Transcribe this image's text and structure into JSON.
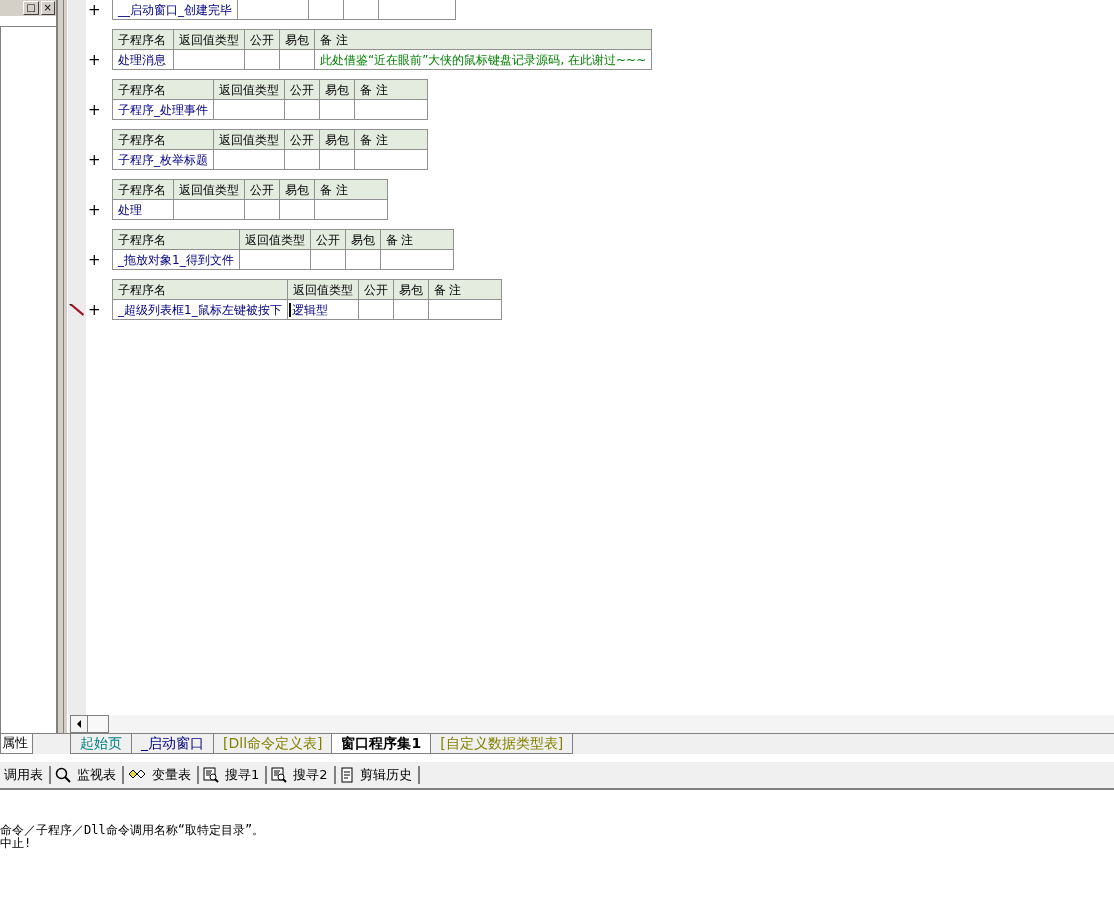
{
  "left_panel": {
    "buttons": [
      "□",
      "×"
    ],
    "tab": "属性"
  },
  "procedures": [
    {
      "name": "__启动窗口_创建完毕",
      "editing": false
    },
    {
      "columns": [
        "子程序名",
        "返回值类型",
        "公开",
        "易包",
        "备 注"
      ],
      "name": "处理消息",
      "remark": "此处借鉴“近在眼前”大侠的鼠标键盘记录源码, 在此谢过~~~",
      "editing": false
    },
    {
      "columns": [
        "子程序名",
        "返回值类型",
        "公开",
        "易包",
        "备 注"
      ],
      "name": "子程序_处理事件",
      "editing": false
    },
    {
      "columns": [
        "子程序名",
        "返回值类型",
        "公开",
        "易包",
        "备 注"
      ],
      "name": "子程序_枚举标题",
      "editing": false
    },
    {
      "columns": [
        "子程序名",
        "返回值类型",
        "公开",
        "易包",
        "备 注"
      ],
      "name": "处理",
      "editing": false
    },
    {
      "columns": [
        "子程序名",
        "返回值类型",
        "公开",
        "易包",
        "备 注"
      ],
      "name": "_拖放对象1_得到文件",
      "editing": false
    },
    {
      "columns": [
        "子程序名",
        "返回值类型",
        "公开",
        "易包",
        "备 注"
      ],
      "name": "_超级列表框1_鼠标左键被按下",
      "return_type": "逻辑型",
      "editing": true
    }
  ],
  "expand_sign": "+",
  "tabs": [
    {
      "label": "起始页",
      "selected": false,
      "color": "#008080"
    },
    {
      "label": "_启动窗口",
      "selected": false,
      "color": "#000080"
    },
    {
      "label": "[Dll命令定义表]",
      "selected": false,
      "color": "#808000"
    },
    {
      "label": "窗口程序集1",
      "selected": true,
      "color": "#000000"
    },
    {
      "label": "[自定义数据类型表]",
      "selected": false,
      "color": "#808000"
    }
  ],
  "toolbar": [
    {
      "label": "调用表",
      "kind": "plain"
    },
    {
      "label": "监视表",
      "kind": "search"
    },
    {
      "label": "变量表",
      "kind": "variables"
    },
    {
      "label": "搜寻1",
      "kind": "find"
    },
    {
      "label": "搜寻2",
      "kind": "find"
    },
    {
      "label": "剪辑历史",
      "kind": "history"
    }
  ],
  "output": [
    "命令／子程序／Dll命令调用名称“取特定目录”。",
    "中止!"
  ]
}
